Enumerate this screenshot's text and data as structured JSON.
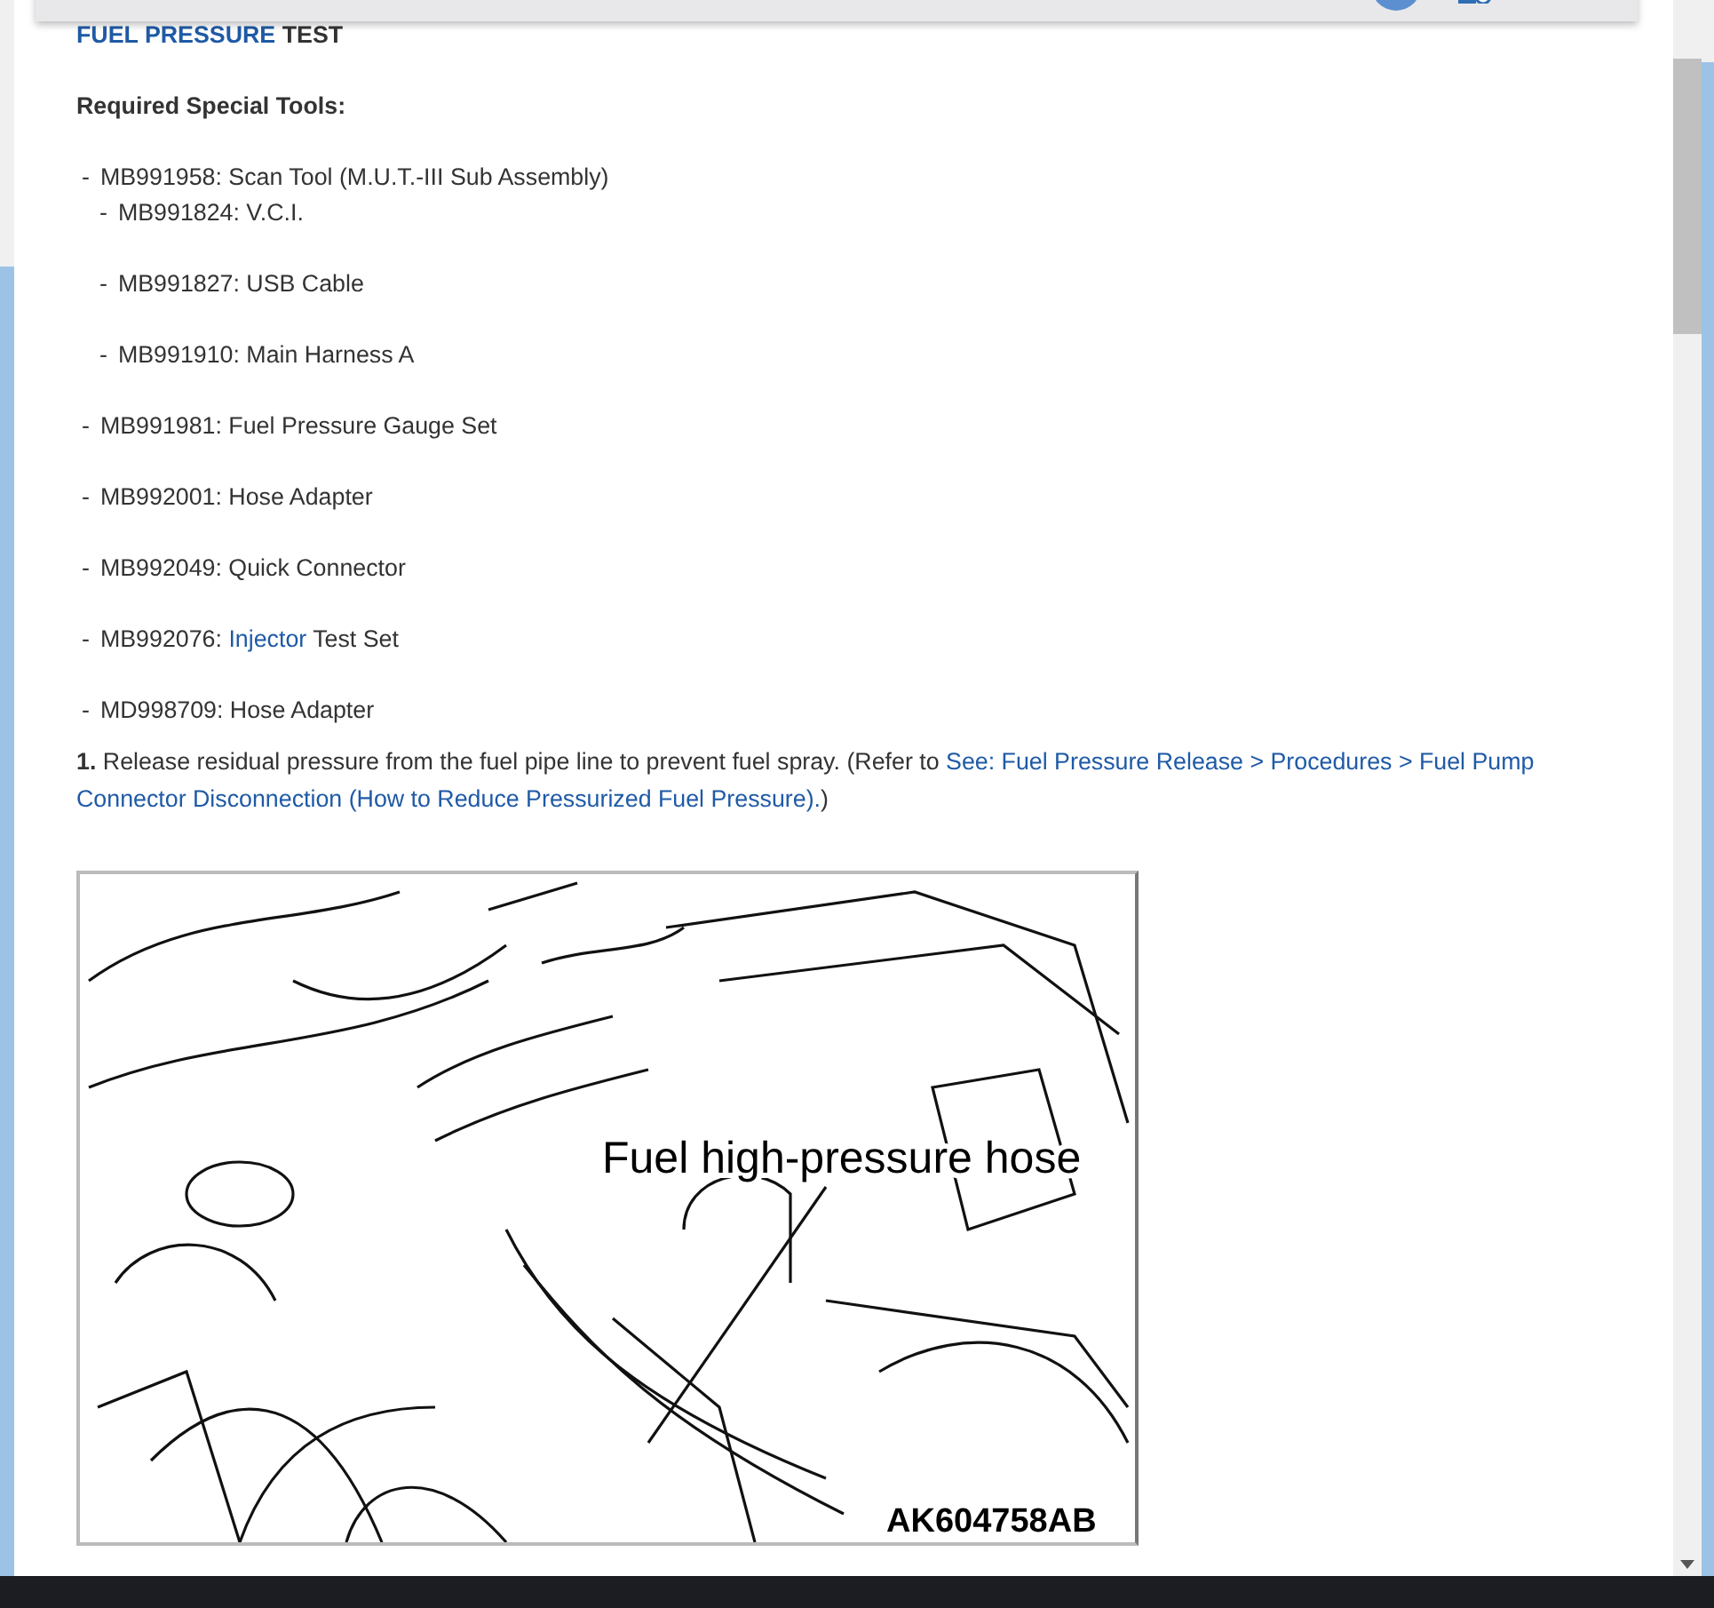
{
  "title": {
    "segments": [
      {
        "text": "FUEL PRESSURE",
        "link": true
      },
      {
        "text": " TEST"
      }
    ]
  },
  "tools_heading": "Required Special Tools:",
  "tools": [
    {
      "bullet": "-",
      "segments": [
        {
          "text": "MB991958: Scan Tool (M.U.T.-III Sub Assembly)"
        }
      ],
      "children": [
        {
          "bullet": "-",
          "segments": [
            {
              "text": "MB991824: V.C.I."
            }
          ]
        },
        {
          "bullet": "-",
          "segments": [
            {
              "text": "MB991827: USB Cable"
            }
          ]
        },
        {
          "bullet": "-",
          "segments": [
            {
              "text": "MB991910: Main Harness A"
            }
          ]
        }
      ]
    },
    {
      "bullet": "-",
      "segments": [
        {
          "text": "MB991981: Fuel Pressure Gauge Set"
        }
      ]
    },
    {
      "bullet": "-",
      "segments": [
        {
          "text": "MB992001: Hose Adapter"
        }
      ]
    },
    {
      "bullet": "-",
      "segments": [
        {
          "text": "MB992049: Quick Connector"
        }
      ]
    },
    {
      "bullet": "-",
      "segments": [
        {
          "text": "MB992076: "
        },
        {
          "text": "Injector",
          "link": true
        },
        {
          "text": " Test Set"
        }
      ]
    },
    {
      "bullet": "-",
      "segments": [
        {
          "text": "MD998709: Hose Adapter"
        }
      ]
    }
  ],
  "steps": [
    {
      "number": "1.",
      "segments": [
        {
          "text": " Release residual pressure from the fuel pipe line to prevent fuel spray. (Refer to "
        },
        {
          "text": "See: Fuel Pressure Release > Procedures > Fuel Pump",
          "link": true
        },
        {
          "text": "Connector Disconnection (How to Reduce Pressurized Fuel Pressure).",
          "link": true
        },
        {
          "text": ")"
        }
      ]
    }
  ],
  "figure": {
    "callout": "Fuel high-pressure hose",
    "code": "AK604758AB"
  }
}
